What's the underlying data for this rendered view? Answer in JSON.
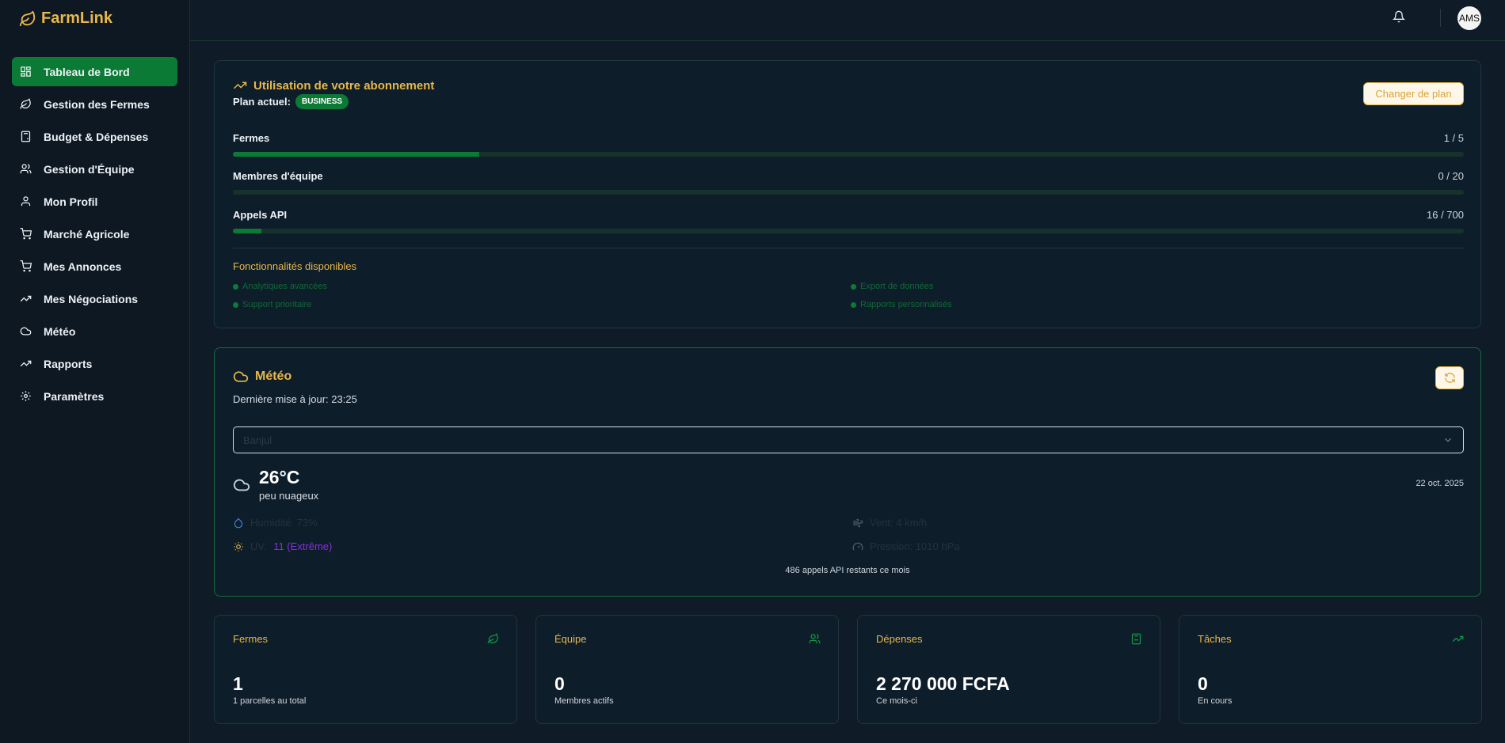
{
  "app": {
    "name": "FarmLink"
  },
  "sidebar": {
    "items": [
      {
        "label": "Tableau de Bord",
        "icon": "dashboard-icon",
        "active": true
      },
      {
        "label": "Gestion des Fermes",
        "icon": "leaf-icon"
      },
      {
        "label": "Budget & Dépenses",
        "icon": "calculator-icon"
      },
      {
        "label": "Gestion d'Équipe",
        "icon": "users-icon"
      },
      {
        "label": "Mon Profil",
        "icon": "user-icon"
      },
      {
        "label": "Marché Agricole",
        "icon": "cart-icon"
      },
      {
        "label": "Mes Annonces",
        "icon": "cart-icon"
      },
      {
        "label": "Mes Négociations",
        "icon": "trending-up-icon"
      },
      {
        "label": "Météo",
        "icon": "cloud-icon"
      },
      {
        "label": "Rapports",
        "icon": "trending-up-icon"
      },
      {
        "label": "Paramètres",
        "icon": "gear-icon"
      }
    ]
  },
  "topbar": {
    "avatar": "AMS"
  },
  "subscription": {
    "title": "Utilisation de votre abonnement",
    "plan_label": "Plan actuel:",
    "plan_name": "BUSINESS",
    "change_plan": "Changer de plan",
    "usage": [
      {
        "label": "Fermes",
        "value": "1 / 5",
        "fraction": 0.2
      },
      {
        "label": "Membres d'équipe",
        "value": "0 / 20",
        "fraction": 0
      },
      {
        "label": "Appels API",
        "value": "16 / 700",
        "fraction": 0.023
      }
    ],
    "features_title": "Fonctionnalités disponibles",
    "features": [
      "Analytiques avancées",
      "Export de données",
      "Support prioritaire",
      "Rapports personnalisés"
    ]
  },
  "weather": {
    "title": "Météo",
    "last_update": "Dernière mise à jour: 23:25",
    "location": "Banjul",
    "temp": "26°C",
    "condition": "peu nuageux",
    "date": "22 oct. 2025",
    "humidity": "Humidité: 73%",
    "wind": "Vent: 4 km/h",
    "uv_label": "UV:",
    "uv_value": "11 (Extrême)",
    "pressure": "Pression: 1010 hPa",
    "api_remaining": "486 appels API restants ce mois"
  },
  "stats": [
    {
      "title": "Fermes",
      "value": "1",
      "sub": "1 parcelles au total",
      "icon": "leaf-icon"
    },
    {
      "title": "Équipe",
      "value": "0",
      "sub": "Membres actifs",
      "icon": "users-icon"
    },
    {
      "title": "Dépenses",
      "value": "2 270 000 FCFA",
      "sub": "Ce mois-ci",
      "icon": "calculator-icon"
    },
    {
      "title": "Tâches",
      "value": "0",
      "sub": "En cours",
      "icon": "trending-up-icon"
    }
  ],
  "colors": {
    "accent": "#e8b84a",
    "primary": "#0b7a35",
    "background": "#0f1b27"
  }
}
